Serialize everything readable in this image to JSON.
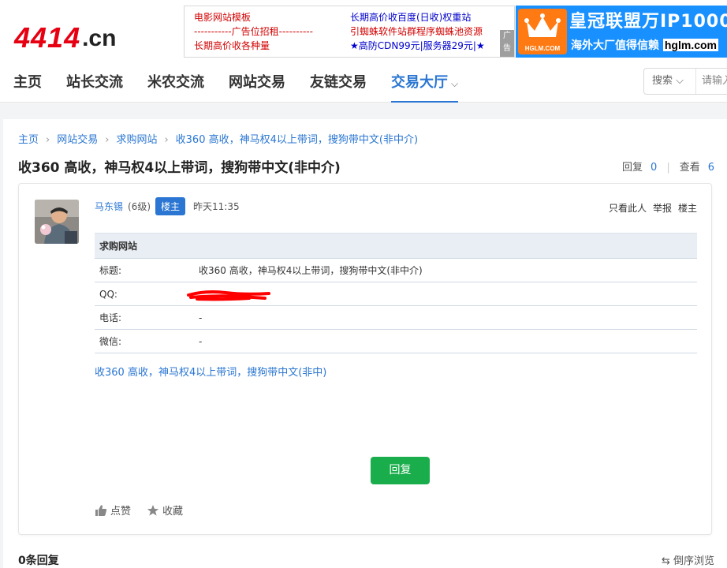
{
  "header": {
    "logo_mark": "4414",
    "logo_suffix": ".cn",
    "ad_left": {
      "col1": [
        "电影网站模板",
        "-----------广告位招租----------",
        "长期高价收各种量"
      ],
      "col2": [
        "长期高价收百度(日收)权重站",
        "引蜘蛛软件站群程序蜘蛛池资源",
        "★高防CDN99元|服务器29元|★"
      ],
      "tag": "广告"
    },
    "ad_right": {
      "brand": "HGLM.COM",
      "headline": "皇冠联盟万IP1000",
      "subline": "海外大厂值得信赖",
      "domain": "hglm.com",
      "colors": {
        "background": "#1890ff",
        "crown_box": "#ff7a12"
      }
    }
  },
  "nav": {
    "items": [
      "主页",
      "站长交流",
      "米农交流",
      "网站交易",
      "友链交易",
      "交易大厅"
    ],
    "active_index": 5,
    "search_type": "搜索",
    "search_placeholder": "请输入"
  },
  "breadcrumb": [
    "主页",
    "网站交易",
    "求购网站",
    "收360 高收，神马权4以上带词，搜狗带中文(非中介)"
  ],
  "thread": {
    "title": "收360 高收，神马权4以上带词，搜狗带中文(非中介)",
    "reply_label": "回复",
    "reply_count": "0",
    "view_label": "查看",
    "view_count": "6"
  },
  "post": {
    "author": "马东锡",
    "level": "(6级)",
    "badge": "楼主",
    "time": "昨天11:35",
    "actions": [
      "只看此人",
      "举报",
      "楼主"
    ],
    "table_title": "求购网站",
    "rows": [
      {
        "key": "标题:",
        "value": "收360 高收，神马权4以上带词，搜狗带中文(非中介)"
      },
      {
        "key": "QQ:",
        "value": ""
      },
      {
        "key": "电话:",
        "value": "-"
      },
      {
        "key": "微信:",
        "value": "-"
      }
    ],
    "description": "收360 高收，神马权4以上带词，搜狗带中文(非中)",
    "reply_button": "回复",
    "like_label": "点赞",
    "fav_label": "收藏"
  },
  "footer": {
    "replies_count": "0条回复",
    "sort_label": "倒序浏览"
  },
  "colors": {
    "accent": "#2a76d2",
    "brand_red": "#e60012",
    "reply_green": "#1aad4b",
    "redaction": "#ff0000"
  }
}
